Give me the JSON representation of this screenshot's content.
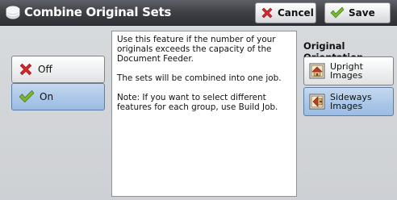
{
  "title": "Combine Original Sets",
  "toolbar": {
    "cancel_label": "Cancel",
    "save_label": "Save"
  },
  "options": {
    "off_label": "Off",
    "on_label": "On",
    "selected": "On"
  },
  "info": {
    "para1": "Use this feature if the number of your originals exceeds the capacity of the Document Feeder.",
    "para2": "The sets will be combined into one job.",
    "para3": "Note: If you want to select different features for each group, use Build Job."
  },
  "orientation": {
    "heading": "Original Orientation",
    "upright_label": "Upright Images",
    "sideways_label": "Sideways Images",
    "selected": "Sideways Images"
  },
  "colors": {
    "titlebar": "#3e4046",
    "selected": "#a9c6e8",
    "cancel_x": "#d9262b",
    "check": "#7ab82b"
  }
}
